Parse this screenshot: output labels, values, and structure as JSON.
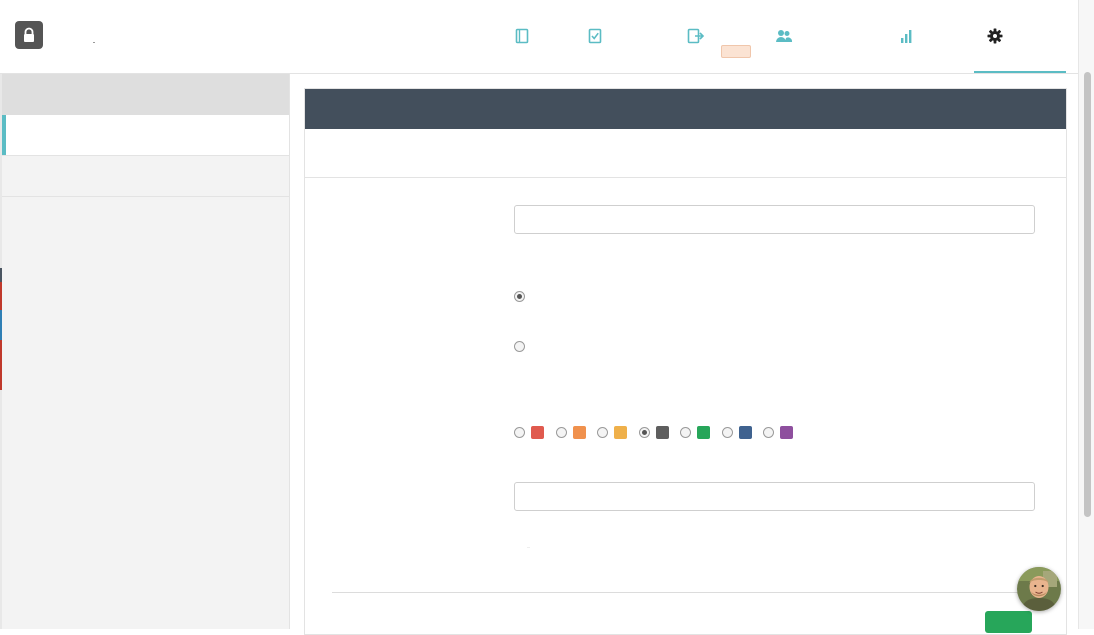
{
  "header": {
    "nav": [
      {
        "name": "book-icon",
        "color": "#5bbcc4"
      },
      {
        "name": "checklist-icon",
        "color": "#5bbcc4"
      },
      {
        "name": "export-icon",
        "color": "#5bbcc4"
      },
      {
        "name": "users-icon",
        "color": "#5bbcc4"
      },
      {
        "name": "bar-chart-icon",
        "color": "#5bbcc4"
      },
      {
        "name": "gear-icon",
        "color": "#222222",
        "active": true
      }
    ]
  },
  "sidebar": {
    "accent_color": "#5bbcc4",
    "items": [
      {
        "label": "",
        "active": true
      },
      {
        "label": "",
        "active": false
      }
    ]
  },
  "panel": {
    "header_color": "#434f5c",
    "title": "",
    "subtitle": ""
  },
  "form": {
    "field_1": {
      "value": "",
      "placeholder": ""
    },
    "radio_options": [
      {
        "label": "",
        "checked": true
      },
      {
        "label": "",
        "checked": false
      }
    ],
    "color_options": [
      {
        "color": "#e05a4e",
        "checked": false
      },
      {
        "color": "#f0914d",
        "checked": false
      },
      {
        "color": "#efb04a",
        "checked": false
      },
      {
        "color": "#5e5e5e",
        "checked": true
      },
      {
        "color": "#27a65a",
        "checked": false
      },
      {
        "color": "#3f628f",
        "checked": false
      },
      {
        "color": "#8e4f9e",
        "checked": false
      }
    ],
    "field_2": {
      "value": "",
      "placeholder": ""
    },
    "save_label": "",
    "save_color": "#27a65a"
  }
}
